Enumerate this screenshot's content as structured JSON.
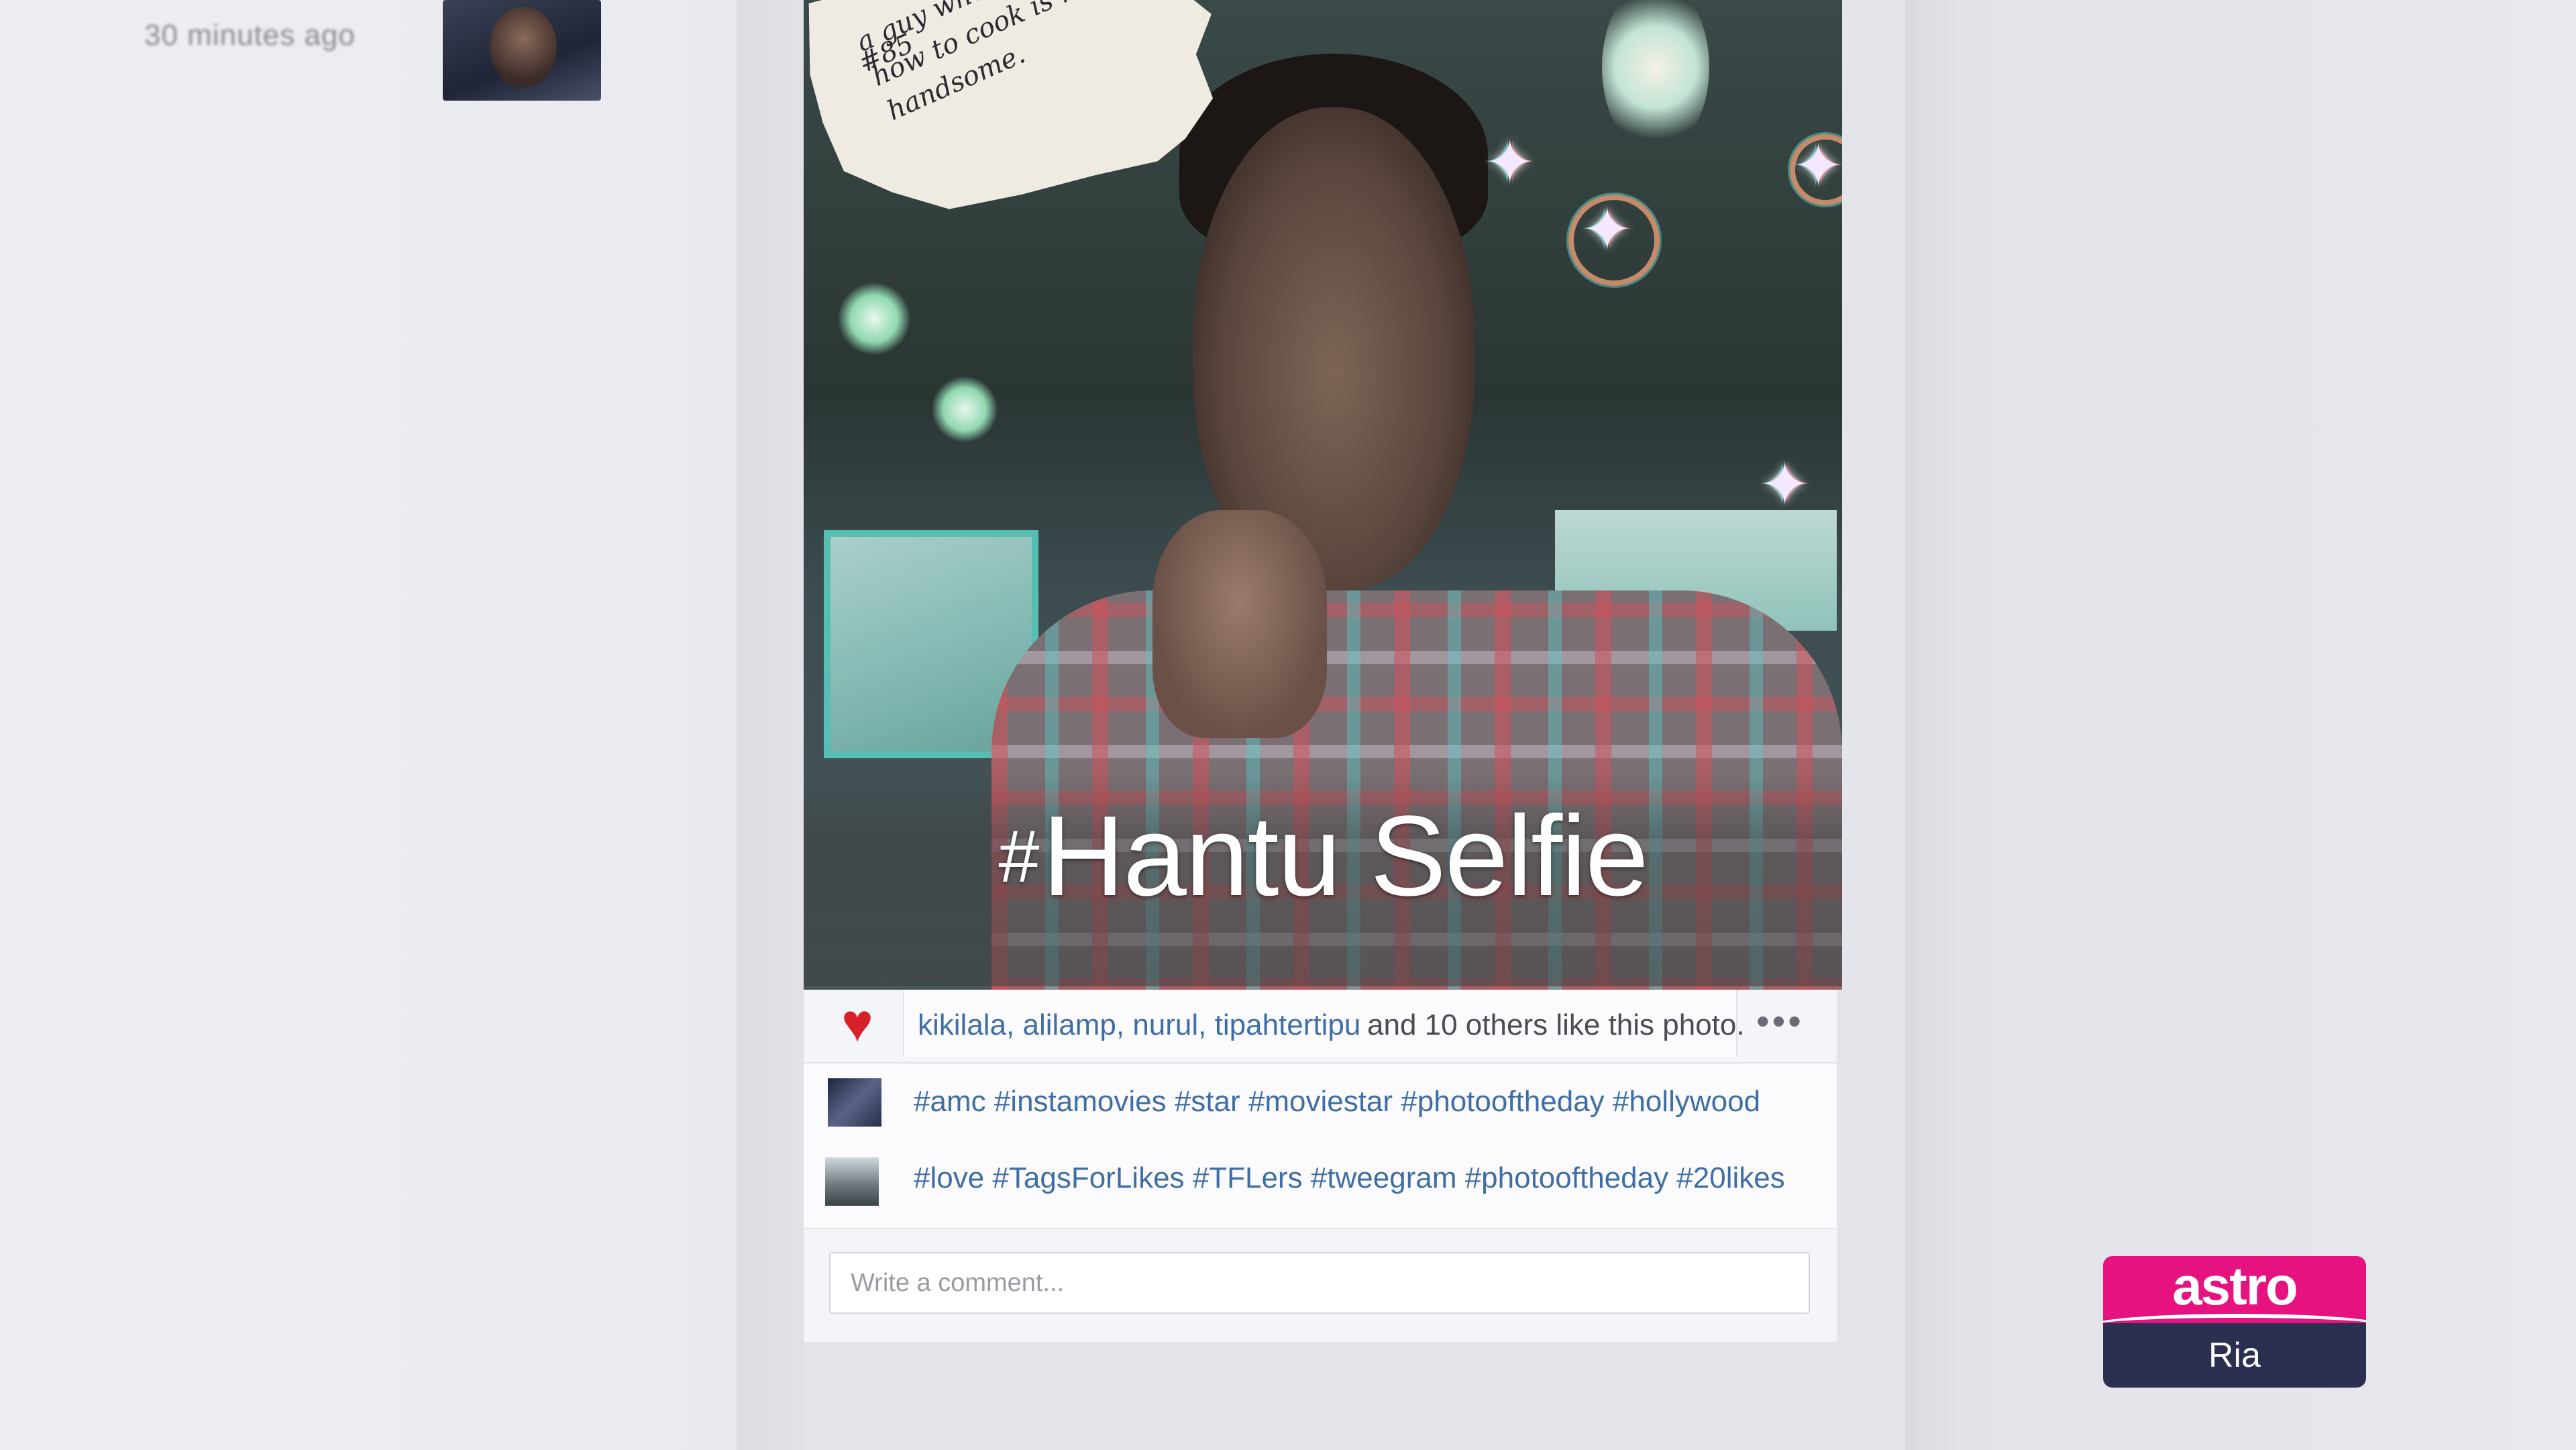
{
  "background": {
    "timestamp": "30 minutes ago"
  },
  "post": {
    "note": {
      "tag": "#85",
      "text": "a guy who knows\nhow to cook is really\nhandsome."
    },
    "caption": {
      "hash": "#",
      "text": "Hantu Selfie"
    }
  },
  "likes": {
    "likers": "kikilala, alilamp, nurul, tipahtertipu",
    "rest": "and 10 others like this photo.",
    "more_label": "•••"
  },
  "comments": [
    {
      "text": "#amc #instamovies #star #moviestar #photooftheday #hollywood"
    },
    {
      "text": "#love #TagsForLikes #TFLers #tweegram #photooftheday #20likes"
    }
  ],
  "comment_input": {
    "placeholder": "Write a comment..."
  },
  "channel_logo": {
    "top": "astro",
    "bottom": "Ria"
  },
  "colors": {
    "link": "#3f6ea4",
    "heart": "#d8202a",
    "astro_pink": "#e6127f",
    "astro_navy": "#2c3050"
  },
  "icons": [
    "heart-icon",
    "more-options-icon"
  ]
}
